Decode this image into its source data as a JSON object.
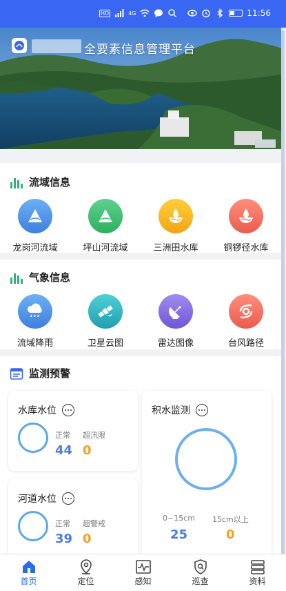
{
  "statusbar": {
    "time": "11:56",
    "network_type": "4G"
  },
  "header": {
    "title": "全要素信息管理平台"
  },
  "basin": {
    "title": "流域信息",
    "items": [
      {
        "label": "龙岗河流域",
        "icon": "river-basin-icon",
        "color": "#4d8fe8"
      },
      {
        "label": "坪山河流域",
        "icon": "river-basin-icon",
        "color": "#3dbf73"
      },
      {
        "label": "三洲田水库",
        "icon": "reservoir-icon",
        "color": "#f5b321"
      },
      {
        "label": "铜锣径水库",
        "icon": "reservoir-icon",
        "color": "#f07466"
      }
    ]
  },
  "weather": {
    "title": "气象信息",
    "items": [
      {
        "label": "流域降雨",
        "icon": "rain-cloud-icon",
        "color": "#4d8fe8"
      },
      {
        "label": "卫星云图",
        "icon": "satellite-icon",
        "color": "#2bb3c0"
      },
      {
        "label": "雷达图像",
        "icon": "radar-dish-icon",
        "color": "#8a73e6"
      },
      {
        "label": "台风路径",
        "icon": "typhoon-icon",
        "color": "#f07466"
      }
    ]
  },
  "monitor": {
    "title": "监测预警",
    "reservoir": {
      "title": "水库水位",
      "normal_label": "正常",
      "normal_value": "44",
      "over_label": "超汛限",
      "over_value": "0"
    },
    "river": {
      "title": "河道水位",
      "normal_label": "正常",
      "normal_value": "39",
      "over_label": "超警戒",
      "over_value": "0"
    },
    "waterlog": {
      "title": "积水监测",
      "low_label": "0~15cm",
      "low_value": "25",
      "high_label": "15cm以上",
      "high_value": "0"
    }
  },
  "nav": [
    {
      "label": "首页",
      "icon": "home-icon",
      "active": true
    },
    {
      "label": "定位",
      "icon": "location-pin-icon",
      "active": false
    },
    {
      "label": "感知",
      "icon": "pulse-monitor-icon",
      "active": false
    },
    {
      "label": "巡查",
      "icon": "shield-search-icon",
      "active": false
    },
    {
      "label": "资料",
      "icon": "archive-icon",
      "active": false
    }
  ],
  "colors": {
    "statusbar": "#3a67f2",
    "accent_blue": "#2c6ae6",
    "value_blue": "#4b7de0",
    "value_orange": "#f5a021"
  }
}
